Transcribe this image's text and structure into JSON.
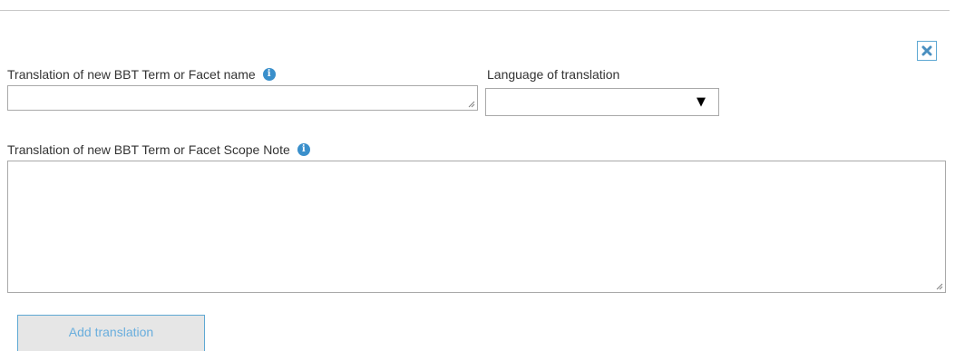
{
  "form": {
    "close_icon": "close-x-icon",
    "term_name": {
      "label": "Translation of new BBT Term or Facet name",
      "value": "",
      "info_icon": "info-icon"
    },
    "language": {
      "label": "Language of translation",
      "selected": "",
      "arrow_icon": "▼"
    },
    "scope_note": {
      "label": "Translation of new BBT Term or Facet Scope Note",
      "value": "",
      "info_icon": "info-icon"
    },
    "add_button_label": "Add translation",
    "colors": {
      "accent": "#3a8fcb",
      "close_icon": "#4a8fc0",
      "button_text": "#6aaedd",
      "button_bg": "#e6e6e6"
    }
  }
}
